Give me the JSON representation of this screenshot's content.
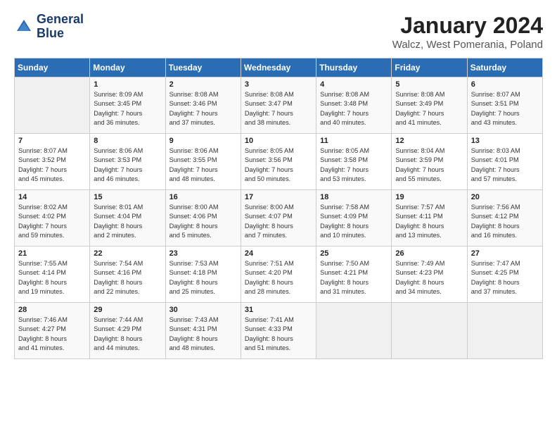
{
  "logo": {
    "line1": "General",
    "line2": "Blue"
  },
  "title": "January 2024",
  "subtitle": "Walcz, West Pomerania, Poland",
  "days_of_week": [
    "Sunday",
    "Monday",
    "Tuesday",
    "Wednesday",
    "Thursday",
    "Friday",
    "Saturday"
  ],
  "weeks": [
    [
      {
        "num": "",
        "info": ""
      },
      {
        "num": "1",
        "info": "Sunrise: 8:09 AM\nSunset: 3:45 PM\nDaylight: 7 hours\nand 36 minutes."
      },
      {
        "num": "2",
        "info": "Sunrise: 8:08 AM\nSunset: 3:46 PM\nDaylight: 7 hours\nand 37 minutes."
      },
      {
        "num": "3",
        "info": "Sunrise: 8:08 AM\nSunset: 3:47 PM\nDaylight: 7 hours\nand 38 minutes."
      },
      {
        "num": "4",
        "info": "Sunrise: 8:08 AM\nSunset: 3:48 PM\nDaylight: 7 hours\nand 40 minutes."
      },
      {
        "num": "5",
        "info": "Sunrise: 8:08 AM\nSunset: 3:49 PM\nDaylight: 7 hours\nand 41 minutes."
      },
      {
        "num": "6",
        "info": "Sunrise: 8:07 AM\nSunset: 3:51 PM\nDaylight: 7 hours\nand 43 minutes."
      }
    ],
    [
      {
        "num": "7",
        "info": "Sunrise: 8:07 AM\nSunset: 3:52 PM\nDaylight: 7 hours\nand 45 minutes."
      },
      {
        "num": "8",
        "info": "Sunrise: 8:06 AM\nSunset: 3:53 PM\nDaylight: 7 hours\nand 46 minutes."
      },
      {
        "num": "9",
        "info": "Sunrise: 8:06 AM\nSunset: 3:55 PM\nDaylight: 7 hours\nand 48 minutes."
      },
      {
        "num": "10",
        "info": "Sunrise: 8:05 AM\nSunset: 3:56 PM\nDaylight: 7 hours\nand 50 minutes."
      },
      {
        "num": "11",
        "info": "Sunrise: 8:05 AM\nSunset: 3:58 PM\nDaylight: 7 hours\nand 53 minutes."
      },
      {
        "num": "12",
        "info": "Sunrise: 8:04 AM\nSunset: 3:59 PM\nDaylight: 7 hours\nand 55 minutes."
      },
      {
        "num": "13",
        "info": "Sunrise: 8:03 AM\nSunset: 4:01 PM\nDaylight: 7 hours\nand 57 minutes."
      }
    ],
    [
      {
        "num": "14",
        "info": "Sunrise: 8:02 AM\nSunset: 4:02 PM\nDaylight: 7 hours\nand 59 minutes."
      },
      {
        "num": "15",
        "info": "Sunrise: 8:01 AM\nSunset: 4:04 PM\nDaylight: 8 hours\nand 2 minutes."
      },
      {
        "num": "16",
        "info": "Sunrise: 8:00 AM\nSunset: 4:06 PM\nDaylight: 8 hours\nand 5 minutes."
      },
      {
        "num": "17",
        "info": "Sunrise: 8:00 AM\nSunset: 4:07 PM\nDaylight: 8 hours\nand 7 minutes."
      },
      {
        "num": "18",
        "info": "Sunrise: 7:58 AM\nSunset: 4:09 PM\nDaylight: 8 hours\nand 10 minutes."
      },
      {
        "num": "19",
        "info": "Sunrise: 7:57 AM\nSunset: 4:11 PM\nDaylight: 8 hours\nand 13 minutes."
      },
      {
        "num": "20",
        "info": "Sunrise: 7:56 AM\nSunset: 4:12 PM\nDaylight: 8 hours\nand 16 minutes."
      }
    ],
    [
      {
        "num": "21",
        "info": "Sunrise: 7:55 AM\nSunset: 4:14 PM\nDaylight: 8 hours\nand 19 minutes."
      },
      {
        "num": "22",
        "info": "Sunrise: 7:54 AM\nSunset: 4:16 PM\nDaylight: 8 hours\nand 22 minutes."
      },
      {
        "num": "23",
        "info": "Sunrise: 7:53 AM\nSunset: 4:18 PM\nDaylight: 8 hours\nand 25 minutes."
      },
      {
        "num": "24",
        "info": "Sunrise: 7:51 AM\nSunset: 4:20 PM\nDaylight: 8 hours\nand 28 minutes."
      },
      {
        "num": "25",
        "info": "Sunrise: 7:50 AM\nSunset: 4:21 PM\nDaylight: 8 hours\nand 31 minutes."
      },
      {
        "num": "26",
        "info": "Sunrise: 7:49 AM\nSunset: 4:23 PM\nDaylight: 8 hours\nand 34 minutes."
      },
      {
        "num": "27",
        "info": "Sunrise: 7:47 AM\nSunset: 4:25 PM\nDaylight: 8 hours\nand 37 minutes."
      }
    ],
    [
      {
        "num": "28",
        "info": "Sunrise: 7:46 AM\nSunset: 4:27 PM\nDaylight: 8 hours\nand 41 minutes."
      },
      {
        "num": "29",
        "info": "Sunrise: 7:44 AM\nSunset: 4:29 PM\nDaylight: 8 hours\nand 44 minutes."
      },
      {
        "num": "30",
        "info": "Sunrise: 7:43 AM\nSunset: 4:31 PM\nDaylight: 8 hours\nand 48 minutes."
      },
      {
        "num": "31",
        "info": "Sunrise: 7:41 AM\nSunset: 4:33 PM\nDaylight: 8 hours\nand 51 minutes."
      },
      {
        "num": "",
        "info": ""
      },
      {
        "num": "",
        "info": ""
      },
      {
        "num": "",
        "info": ""
      }
    ]
  ]
}
